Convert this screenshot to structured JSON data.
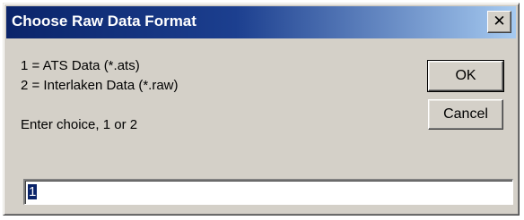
{
  "window": {
    "title": "Choose Raw Data Format",
    "close_label": "✕"
  },
  "message": {
    "line1": "1 = ATS Data (*.ats)",
    "line2": "2 = Interlaken Data (*.raw)",
    "prompt": "Enter choice, 1 or 2"
  },
  "buttons": {
    "ok_label": "OK",
    "cancel_label": "Cancel"
  },
  "input": {
    "value": "1"
  }
}
